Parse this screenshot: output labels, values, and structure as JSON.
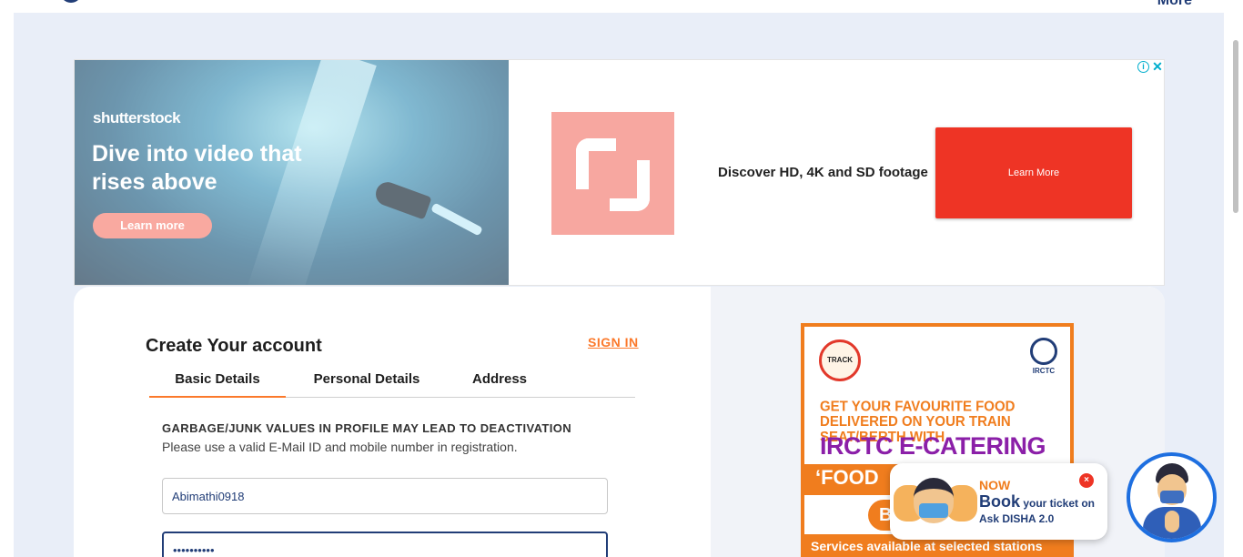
{
  "topbar": {
    "more_label": "More"
  },
  "ad": {
    "brand": "shutterstock",
    "headline": "Dive into video that rises above",
    "left_button": "Learn more",
    "tagline": "Discover HD, 4K and SD footage",
    "cta": "Learn More",
    "info": "i",
    "close": "✕",
    "colors": {
      "cta": "#ee3425",
      "mark": "#f7a7a0"
    }
  },
  "form": {
    "title": "Create Your account",
    "sign_in": "SIGN IN",
    "tabs": [
      {
        "label": "Basic Details",
        "active": true
      },
      {
        "label": "Personal Details",
        "active": false
      },
      {
        "label": "Address",
        "active": false
      }
    ],
    "warning_title": "GARBAGE/JUNK VALUES IN PROFILE MAY LEAD TO DEACTIVATION",
    "warning_text": "Please use a valid E-Mail ID and mobile number in registration.",
    "username_value": "Abimathi0918",
    "password_value": "••••••••••"
  },
  "food_ad": {
    "logo_text": "TRACK",
    "irctc_label": "IRCTC",
    "line1": "GET YOUR FAVOURITE FOOD DELIVERED ON YOUR TRAIN SEAT/BERTH WITH",
    "line2": "IRCTC E-CATERING",
    "band_text": "‘FOOD",
    "button_text": "B",
    "footer": "Services available at selected stations",
    "colors": {
      "orange": "#f07d1e",
      "purple": "#8b1fa8"
    }
  },
  "disha": {
    "now": "NOW",
    "book": "Book",
    "book_rest": " your ticket on",
    "ask": "Ask DISHA 2.0",
    "close": "×"
  },
  "colors": {
    "accent": "#fb792b",
    "navy": "#213d77",
    "page_bg": "#e9eef8"
  }
}
